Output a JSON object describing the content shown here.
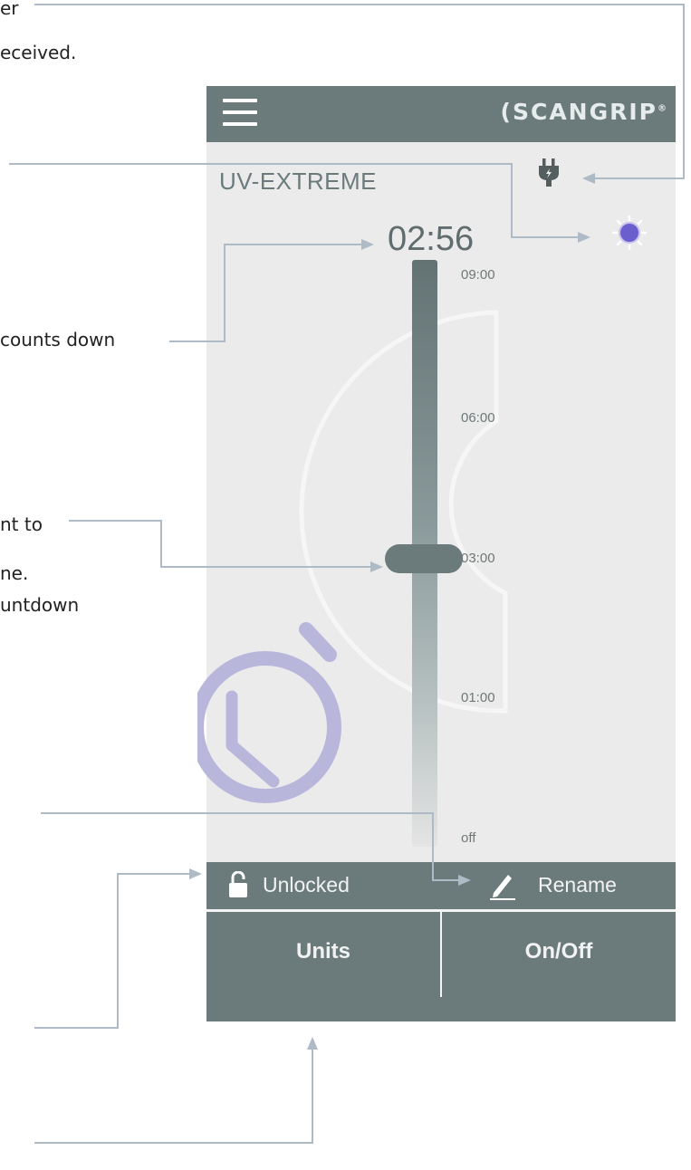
{
  "annotations": {
    "power_line1": "er",
    "power_line2": "eceived.",
    "countdown_note": "counts down",
    "slider_line1": "nt to",
    "slider_line2": "ne.",
    "slider_line3": "untdown"
  },
  "app": {
    "logo_text": "(SCANGRIP",
    "logo_mark": "®",
    "menu_icon": "hamburger-menu-icon",
    "device_name": "UV-EXTREME",
    "countdown": "02:56",
    "status_icons": [
      "plug-icon",
      "uv-light-icon"
    ],
    "slider": {
      "ticks": [
        "09:00",
        "06:00",
        "03:00",
        "01:00",
        "off"
      ],
      "position_label": "03:00"
    },
    "lock": {
      "label": "Unlocked",
      "icon": "unlocked-padlock-icon"
    },
    "rename": {
      "label": "Rename",
      "icon": "pencil-icon"
    },
    "buttons": {
      "units": "Units",
      "onoff": "On/Off"
    }
  },
  "colors": {
    "bar": "#6b7b7c",
    "screen_bg": "#ebebeb",
    "callout_line": "#aebbc6",
    "timer_icon": "#b9b6dc",
    "uv_light": "#6b5fd0"
  }
}
